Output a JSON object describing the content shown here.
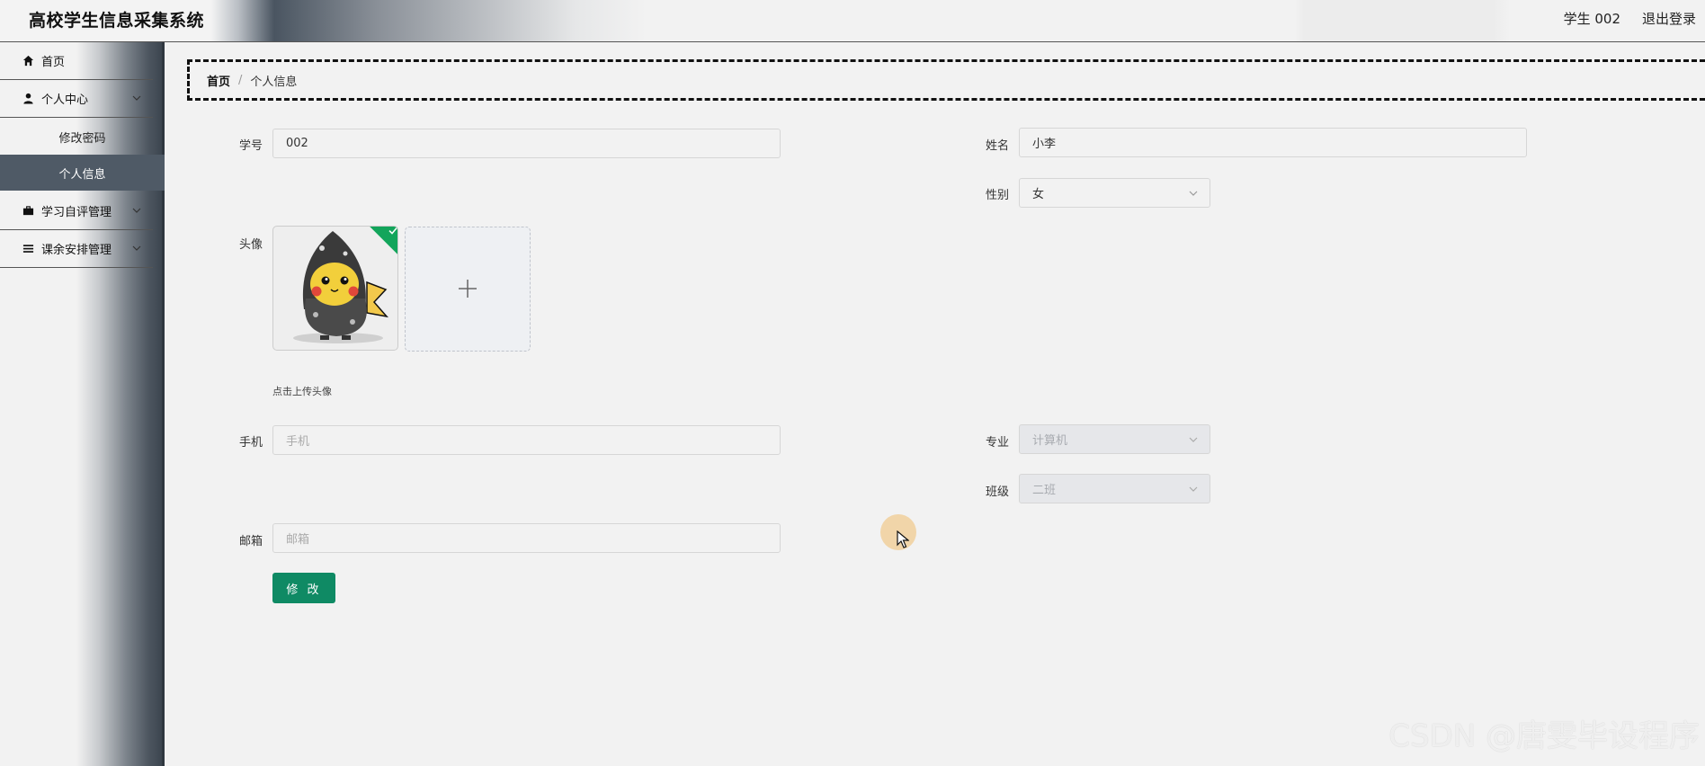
{
  "header": {
    "app_title": "高校学生信息采集系统",
    "user_label": "学生 002",
    "logout_label": "退出登录"
  },
  "sidebar": {
    "items": [
      {
        "label": "首页",
        "icon": "home-icon"
      },
      {
        "label": "个人中心",
        "icon": "user-icon",
        "expanded": true
      },
      {
        "label": "学习自评管理",
        "icon": "briefcase-icon"
      },
      {
        "label": "课余安排管理",
        "icon": "list-icon"
      }
    ],
    "submenu": [
      {
        "label": "修改密码",
        "active": false
      },
      {
        "label": "个人信息",
        "active": true
      }
    ]
  },
  "breadcrumb": {
    "home": "首页",
    "separator": "/",
    "current": "个人信息"
  },
  "form": {
    "student_id": {
      "label": "学号",
      "value": "002"
    },
    "name": {
      "label": "姓名",
      "value": "小李"
    },
    "gender": {
      "label": "性别",
      "value": "女"
    },
    "avatar": {
      "label": "头像",
      "tip": "点击上传头像"
    },
    "phone": {
      "label": "手机",
      "placeholder": "手机"
    },
    "major": {
      "label": "专业",
      "value": "计算机"
    },
    "class": {
      "label": "班级",
      "value": "二班"
    },
    "email": {
      "label": "邮箱",
      "placeholder": "邮箱"
    },
    "submit_label": "修 改"
  },
  "watermark": "CSDN @唐雯毕设程序",
  "colors": {
    "primary_button": "#0f8a64",
    "active_menu": "#4f5a66",
    "upload_success": "#13a55b"
  }
}
